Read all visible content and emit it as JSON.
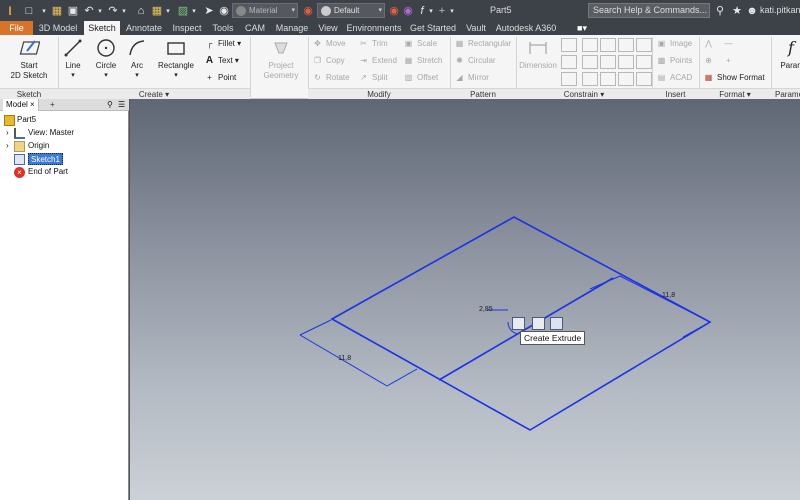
{
  "app": {
    "document_title": "Part5",
    "search_placeholder": "Search Help & Commands...",
    "user": "kati.pitkane"
  },
  "quick_access": {
    "material_value": "Material",
    "appearance_value": "Default"
  },
  "tabs": [
    "File",
    "3D Model",
    "Sketch",
    "Annotate",
    "Inspect",
    "Tools",
    "CAM",
    "Manage",
    "View",
    "Environments",
    "Get Started",
    "Vault",
    "Autodesk A360"
  ],
  "active_tab": "Sketch",
  "ribbon": {
    "sketch_panel": {
      "title": "Sketch",
      "start_line1": "Start",
      "start_line2": "2D Sketch"
    },
    "create_panel": {
      "title": "Create",
      "line": "Line",
      "circle": "Circle",
      "arc": "Arc",
      "rectangle": "Rectangle",
      "fillet": "Fillet",
      "text": "Text",
      "point": "Point"
    },
    "project_geometry": {
      "line1": "Project",
      "line2": "Geometry"
    },
    "modify_panel": {
      "title": "Modify",
      "move": "Move",
      "copy": "Copy",
      "rotate": "Rotate",
      "trim": "Trim",
      "extend": "Extend",
      "split": "Split",
      "scale": "Scale",
      "stretch": "Stretch",
      "offset": "Offset"
    },
    "pattern_panel": {
      "title": "Pattern",
      "rectangular": "Rectangular",
      "circular": "Circular",
      "mirror": "Mirror"
    },
    "constrain_panel": {
      "title": "Constrain",
      "dimension": "Dimension"
    },
    "insert_panel": {
      "title": "Insert",
      "image": "Image",
      "points": "Points",
      "acad": "ACAD"
    },
    "format_panel": {
      "title": "Format",
      "show_format": "Show Format"
    },
    "parameters_panel": {
      "title": "Parame",
      "label": "Paran"
    }
  },
  "browser": {
    "tab": "Model",
    "add": "+",
    "items": [
      "Part5",
      "View: Master",
      "Origin",
      "Sketch1",
      "End of Part"
    ]
  },
  "canvas": {
    "dim_center": "2,85",
    "dim_left": "11,8",
    "dim_right": "11,8",
    "tooltip": "Create Extrude"
  },
  "colors": {
    "accent_file": "#d8742a",
    "sketch_line": "#1a33e6",
    "selected": "#3a7bd5"
  }
}
